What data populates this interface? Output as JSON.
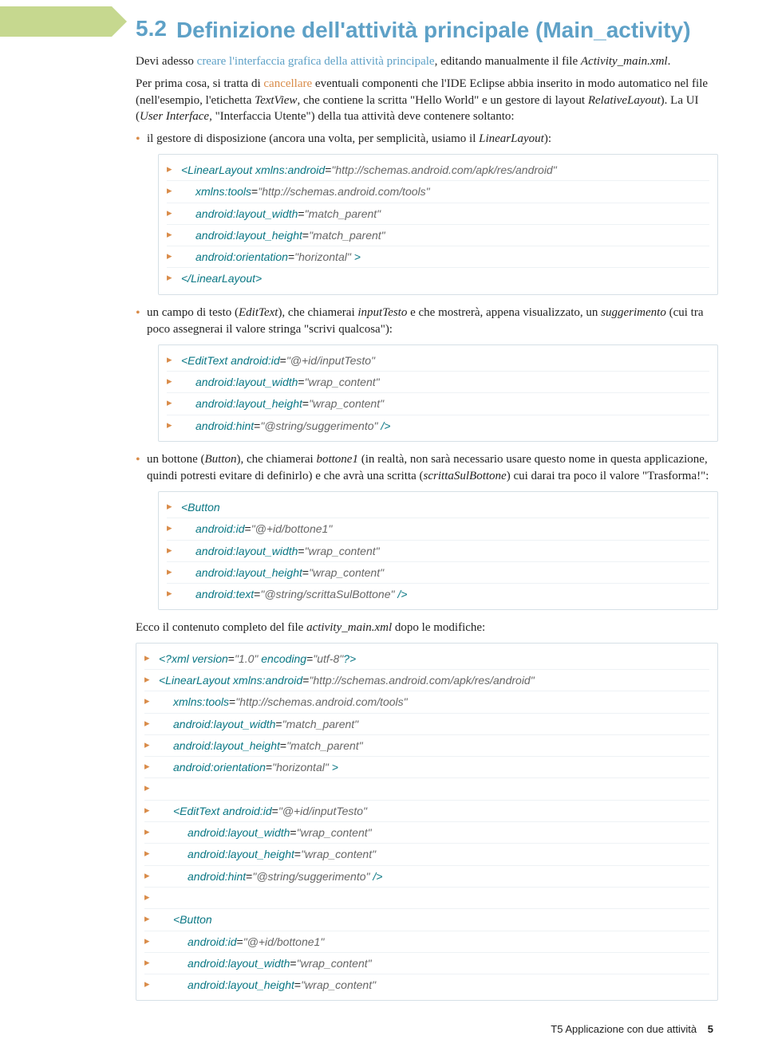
{
  "section_number": "5.2",
  "title": "Definizione dell'attività principale (Main_activity)",
  "intro": {
    "pre": "Devi adesso ",
    "hl": "creare l'interfaccia grafica della attività principale",
    "post": ", editando manualmente il file ",
    "file": "Activity_main.xml",
    "dot": "."
  },
  "para2": {
    "a": "Per prima cosa, si tratta di ",
    "hl": "cancellare",
    "b": " eventuali componenti che l'IDE Eclipse abbia inserito in modo automatico nel file (nell'esempio, l'etichetta ",
    "tv": "TextView",
    "c": ", che contiene la scritta \"Hello World\" e un gestore di layout ",
    "rl": "RelativeLayout",
    "d": "). La UI (",
    "ui1": "User Interface",
    "e": ", \"Interfaccia Utente\") della tua attività deve contenere soltanto:"
  },
  "bullet1": {
    "a": "il gestore di disposizione (ancora una volta, per semplicità, usiamo il ",
    "ll": "LinearLayout",
    "b": "):"
  },
  "code1": [
    [
      [
        "tag",
        "<LinearLayout "
      ],
      [
        "attr",
        "xmlns:android"
      ],
      [
        "eq",
        "="
      ],
      [
        "val",
        "\"http://schemas.android.com/apk/res/android\""
      ]
    ],
    [
      [
        "pad1",
        ""
      ],
      [
        "attr",
        "xmlns:tools"
      ],
      [
        "eq",
        "="
      ],
      [
        "val",
        "\"http://schemas.android.com/tools\""
      ]
    ],
    [
      [
        "pad1",
        ""
      ],
      [
        "attr",
        "android:layout_width"
      ],
      [
        "eq",
        "="
      ],
      [
        "val",
        "\"match_parent\""
      ]
    ],
    [
      [
        "pad1",
        ""
      ],
      [
        "attr",
        "android:layout_height"
      ],
      [
        "eq",
        "="
      ],
      [
        "val",
        "\"match_parent\""
      ]
    ],
    [
      [
        "pad1",
        ""
      ],
      [
        "attr",
        "android:orientation"
      ],
      [
        "eq",
        "="
      ],
      [
        "val",
        "\"horizontal\" "
      ],
      [
        "tag",
        ">"
      ]
    ],
    [
      [
        "tag",
        "</LinearLayout>"
      ]
    ]
  ],
  "bullet2": {
    "a": "un campo di testo (",
    "et": "EditText",
    "b": "), che chiamerai ",
    "name": "inputTesto",
    "c": " e che mostrerà, appena visualizzato, un ",
    "sugg": "suggerimento",
    "d": " (cui tra poco assegnerai il valore stringa \"scrivi qualcosa\"):"
  },
  "code2": [
    [
      [
        "tag",
        "<EditText "
      ],
      [
        "attr",
        "android:id"
      ],
      [
        "eq",
        "="
      ],
      [
        "val",
        "\"@+id/inputTesto\""
      ]
    ],
    [
      [
        "pad1",
        ""
      ],
      [
        "attr",
        "android:layout_width"
      ],
      [
        "eq",
        "="
      ],
      [
        "val",
        "\"wrap_content\""
      ]
    ],
    [
      [
        "pad1",
        ""
      ],
      [
        "attr",
        "android:layout_height"
      ],
      [
        "eq",
        "="
      ],
      [
        "val",
        "\"wrap_content\""
      ]
    ],
    [
      [
        "pad1",
        ""
      ],
      [
        "attr",
        "android:hint"
      ],
      [
        "eq",
        "="
      ],
      [
        "val",
        "\"@string/suggerimento\" "
      ],
      [
        "tag",
        "/>"
      ]
    ]
  ],
  "bullet3": {
    "a": "un bottone (",
    "bt": "Button",
    "b": "), che chiamerai ",
    "name": "bottone1",
    "c": " (in realtà, non sarà necessario usare questo nome in questa applicazione, quindi potresti evitare di definirlo) e che avrà una scritta (",
    "scritta": "scrittaSulBottone",
    "d": ") cui darai tra poco il valore \"Trasforma!\":"
  },
  "code3": [
    [
      [
        "tag",
        "<Button"
      ]
    ],
    [
      [
        "pad1",
        ""
      ],
      [
        "attr",
        "android:id"
      ],
      [
        "eq",
        "="
      ],
      [
        "val",
        "\"@+id/bottone1\""
      ]
    ],
    [
      [
        "pad1",
        ""
      ],
      [
        "attr",
        "android:layout_width"
      ],
      [
        "eq",
        "="
      ],
      [
        "val",
        "\"wrap_content\""
      ]
    ],
    [
      [
        "pad1",
        ""
      ],
      [
        "attr",
        "android:layout_height"
      ],
      [
        "eq",
        "="
      ],
      [
        "val",
        "\"wrap_content\""
      ]
    ],
    [
      [
        "pad1",
        ""
      ],
      [
        "attr",
        "android:text"
      ],
      [
        "eq",
        "="
      ],
      [
        "val",
        "\"@string/scrittaSulBottone\" "
      ],
      [
        "tag",
        "/>"
      ]
    ]
  ],
  "para3": {
    "a": "Ecco il contenuto completo del file ",
    "file": "activity_main.xml",
    "b": " dopo le modifiche:"
  },
  "code4": [
    [
      [
        "tag",
        "<?"
      ],
      [
        "attr",
        "xml version"
      ],
      [
        "eq",
        "="
      ],
      [
        "val",
        "\"1.0\" "
      ],
      [
        "attr",
        "encoding"
      ],
      [
        "eq",
        "="
      ],
      [
        "val",
        "\"utf-8\""
      ],
      [
        "tag",
        "?>"
      ]
    ],
    [
      [
        "tag",
        "<LinearLayout "
      ],
      [
        "attr",
        "xmlns:android"
      ],
      [
        "eq",
        "="
      ],
      [
        "val",
        "\"http://schemas.android.com/apk/res/android\""
      ]
    ],
    [
      [
        "pad1",
        ""
      ],
      [
        "attr",
        "xmlns:tools"
      ],
      [
        "eq",
        "="
      ],
      [
        "val",
        "\"http://schemas.android.com/tools\""
      ]
    ],
    [
      [
        "pad1",
        ""
      ],
      [
        "attr",
        "android:layout_width"
      ],
      [
        "eq",
        "="
      ],
      [
        "val",
        "\"match_parent\""
      ]
    ],
    [
      [
        "pad1",
        ""
      ],
      [
        "attr",
        "android:layout_height"
      ],
      [
        "eq",
        "="
      ],
      [
        "val",
        "\"match_parent\""
      ]
    ],
    [
      [
        "pad1",
        ""
      ],
      [
        "attr",
        "android:orientation"
      ],
      [
        "eq",
        "="
      ],
      [
        "val",
        "\"horizontal\" "
      ],
      [
        "tag",
        ">"
      ]
    ],
    [
      [
        "blank",
        " "
      ]
    ],
    [
      [
        "pad1",
        ""
      ],
      [
        "tag",
        "<EditText "
      ],
      [
        "attr",
        "android:id"
      ],
      [
        "eq",
        "="
      ],
      [
        "val",
        "\"@+id/inputTesto\""
      ]
    ],
    [
      [
        "pad2",
        ""
      ],
      [
        "attr",
        "android:layout_width"
      ],
      [
        "eq",
        "="
      ],
      [
        "val",
        "\"wrap_content\""
      ]
    ],
    [
      [
        "pad2",
        ""
      ],
      [
        "attr",
        "android:layout_height"
      ],
      [
        "eq",
        "="
      ],
      [
        "val",
        "\"wrap_content\""
      ]
    ],
    [
      [
        "pad2",
        ""
      ],
      [
        "attr",
        "android:hint"
      ],
      [
        "eq",
        "="
      ],
      [
        "val",
        "\"@string/suggerimento\" "
      ],
      [
        "tag",
        "/>"
      ]
    ],
    [
      [
        "blank",
        " "
      ]
    ],
    [
      [
        "pad1",
        ""
      ],
      [
        "tag",
        "<Button"
      ]
    ],
    [
      [
        "pad2",
        ""
      ],
      [
        "attr",
        "android:id"
      ],
      [
        "eq",
        "="
      ],
      [
        "val",
        "\"@+id/bottone1\""
      ]
    ],
    [
      [
        "pad2",
        ""
      ],
      [
        "attr",
        "android:layout_width"
      ],
      [
        "eq",
        "="
      ],
      [
        "val",
        "\"wrap_content\""
      ]
    ],
    [
      [
        "pad2",
        ""
      ],
      [
        "attr",
        "android:layout_height"
      ],
      [
        "eq",
        "="
      ],
      [
        "val",
        "\"wrap_content\""
      ]
    ]
  ],
  "footer": {
    "label": "T5  Applicazione con due attività",
    "page": "5"
  }
}
